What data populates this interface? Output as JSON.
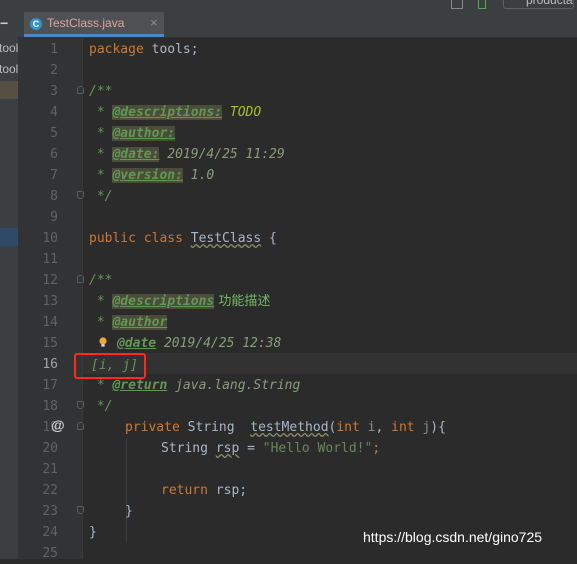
{
  "toolbar": {
    "product_label": "producta"
  },
  "tab": {
    "icon_letter": "C",
    "filename": "TestClass.java",
    "close": "×"
  },
  "left_panel": {
    "collapse": "−",
    "items": [
      "tools",
      "tools"
    ]
  },
  "line_numbers": [
    "1",
    "2",
    "3",
    "4",
    "5",
    "6",
    "7",
    "8",
    "9",
    "10",
    "11",
    "12",
    "13",
    "14",
    "15",
    "16",
    "17",
    "18",
    "19",
    "20",
    "21",
    "22",
    "23",
    "24",
    "25"
  ],
  "current_line": "16",
  "gutter_marker": "@",
  "code": {
    "l1_kw": "package",
    "l1_rest": " tools;",
    "l3": "/**",
    "l4_star": " * ",
    "l4_tag": "@descriptions:",
    "l4_val": " TODO",
    "l5_star": " * ",
    "l5_tag": "@author:",
    "l6_star": " * ",
    "l6_tag": "@date:",
    "l6_val": " 2019/4/25 11:29",
    "l7_star": " * ",
    "l7_tag": "@version:",
    "l7_val": " 1.0",
    "l8": " */",
    "l10_kw": "public class ",
    "l10_name": "TestClass",
    "l10_rest": " {",
    "l12": "/**",
    "l13_star": " * ",
    "l13_tag": "@descriptions",
    "l13_val": " 功能描述",
    "l14_star": " * ",
    "l14_tag": "@author",
    "l15_tag": "@date",
    "l15_val": " 2019/4/25 12:38",
    "l16": "[i, j]",
    "l17_star": " * ",
    "l17_tag": "@return",
    "l17_val": " java.lang.String",
    "l18": " */",
    "l19_kw1": "private ",
    "l19_type": "String  ",
    "l19_name": "testMethod",
    "l19_p1": "(",
    "l19_int1": "int ",
    "l19_i": "i",
    "l19_comma": ", ",
    "l19_int2": "int ",
    "l19_j": "j",
    "l19_end": "){",
    "l20_type": "String ",
    "l20_var": "rsp",
    "l20_eq": " = ",
    "l20_str": "\"Hello World!\"",
    "l20_end": ";",
    "l22_kw": "return ",
    "l22_rest": "rsp;",
    "l23": "}",
    "l24": "}"
  },
  "watermark": "https://blog.csdn.net/gino725",
  "colors": {
    "background": "#2b2b2b",
    "keyword": "#cc7832",
    "doc_comment": "#629755",
    "string": "#6a8759",
    "highlight_box": "#ff2a1a"
  }
}
